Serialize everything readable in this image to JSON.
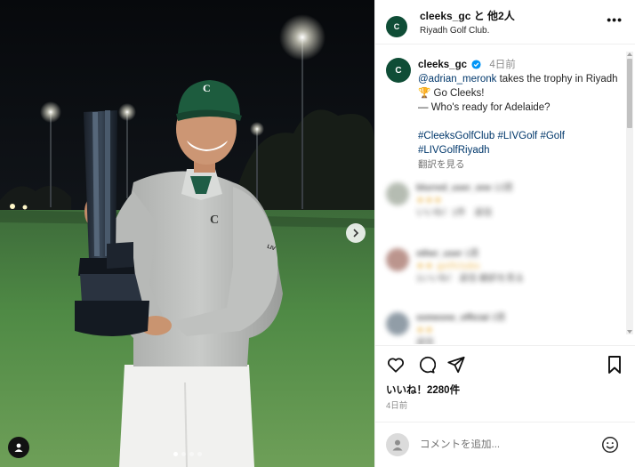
{
  "header": {
    "title": "cleeks_gc と 他2人",
    "location": "Riyadh Golf Club.",
    "avatar_text": "C",
    "more_icon": "more-horizontal-icon"
  },
  "caption": {
    "username": "cleeks_gc",
    "time": "4日前",
    "mention": "@adrian_meronk",
    "text_1": " takes the trophy in Riyadh 🏆 Go Cleeks!",
    "text_2": "— Who's ready for Adelaide?",
    "hashtags": [
      "#CleeksGolfClub",
      "#LIVGolf",
      "#Golf",
      "#LIVGolfRiyadh"
    ],
    "translate": "翻訳を見る"
  },
  "photo": {
    "cap_logo": "C",
    "shirt_logo": "C",
    "sleeve_logo": "LIV"
  },
  "comments": [
    {
      "name": "blurred_user_one",
      "meta": "12週",
      "text": "★★★",
      "sub": "いいね！1件　返信"
    },
    {
      "name": "other_user",
      "meta": "1週",
      "text": "★★ golfclubs",
      "sub": "1いいね！ 返信 翻訳を見る"
    },
    {
      "name": "someone_official",
      "meta": "2週",
      "text": "★★",
      "sub": "返信"
    }
  ],
  "actions": {
    "likes": "いいね！2280件",
    "time_ago": "4日前"
  },
  "comment_box": {
    "placeholder": "コメントを追加..."
  },
  "colors": {
    "brand_green": "#0f4d36",
    "verified_blue": "#0095f6",
    "link_blue": "#00376b"
  }
}
